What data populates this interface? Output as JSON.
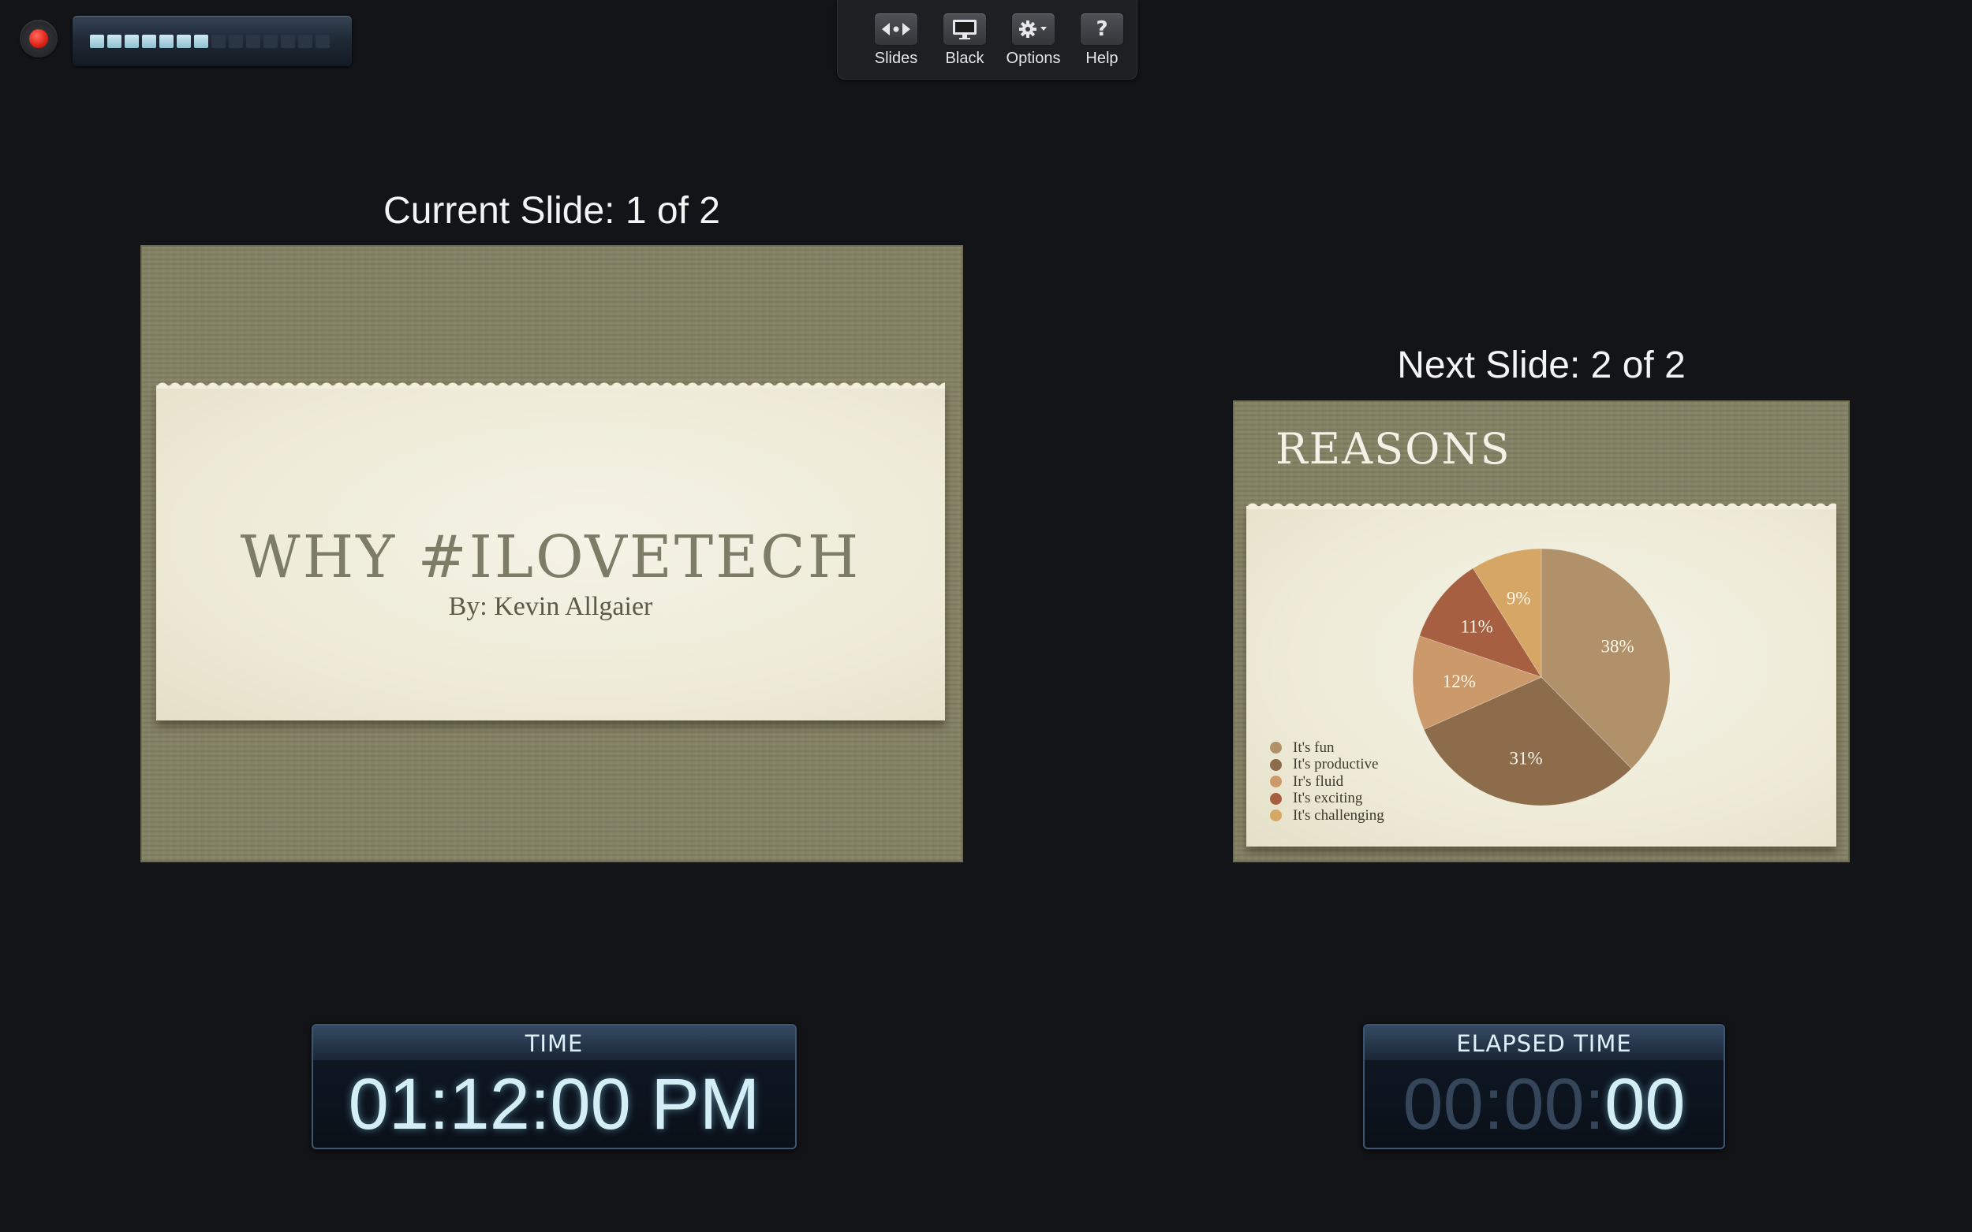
{
  "meter": {
    "level_fraction": 0.5
  },
  "toolbar": {
    "items": [
      {
        "label": "Slides",
        "icon": "slides-nav-icon"
      },
      {
        "label": "Black",
        "icon": "display-icon"
      },
      {
        "label": "Options",
        "icon": "gear-icon"
      },
      {
        "label": "Help",
        "icon": "question-mark-icon",
        "glyph": "?"
      }
    ]
  },
  "current": {
    "caption": "Current Slide: 1 of 2",
    "title": "WHY #ILOVETECH",
    "subtitle": "By: Kevin Allgaier"
  },
  "next": {
    "caption": "Next Slide: 2 of 2",
    "title": "REASONS"
  },
  "chart_data": {
    "type": "pie",
    "title": "",
    "legend_position": "bottom-left",
    "slices": [
      {
        "label": "It's fun",
        "value": 38,
        "display": "38%",
        "color": "#b0916a"
      },
      {
        "label": "It's productive",
        "value": 31,
        "display": "31%",
        "color": "#8c6c4a"
      },
      {
        "label": "Ir's fluid",
        "value": 12,
        "display": "12%",
        "color": "#cc9a6a"
      },
      {
        "label": "It's exciting",
        "value": 11,
        "display": "11%",
        "color": "#a65f40"
      },
      {
        "label": "It's challenging",
        "value": 9,
        "display": "9%",
        "color": "#d6a764"
      }
    ]
  },
  "timers": {
    "time_label": "TIME",
    "time_value": "01:12:00 PM",
    "elapsed_label": "ELAPSED TIME",
    "elapsed_hours": "00",
    "elapsed_minutes": "00",
    "elapsed_seconds": "00",
    "separator": ":"
  }
}
